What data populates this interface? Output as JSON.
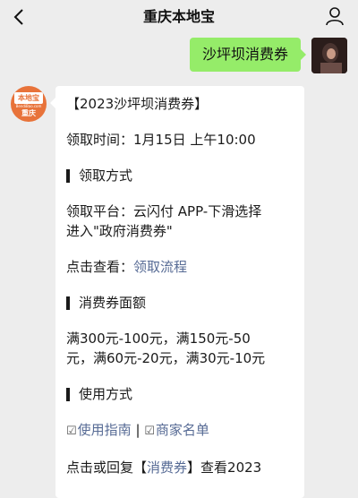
{
  "header": {
    "back_icon": "chevron-left-icon",
    "title": "重庆本地宝",
    "profile_icon": "person-icon"
  },
  "messages": {
    "outgoing": {
      "text": "沙坪坝消费券"
    },
    "bot_avatar": {
      "logo_text": "本地宝",
      "logo_sub": "BendiBao.com",
      "logo_city": "重庆"
    },
    "incoming": {
      "heading": "【2023沙坪坝消费券】",
      "time": "领取时间：1月15日 上午10:00",
      "sec1": "领取方式",
      "platform_line1": "领取平台：云闪付 APP-下滑选择",
      "platform_line2": "进入\"政府消费券\"",
      "view_prefix": "点击查看：",
      "view_link": "领取流程",
      "sec2": "消费券面额",
      "amount_line1": "满300元-100元，满150元-50",
      "amount_line2": "元，满60元-20元，满30元-10元",
      "sec3": "使用方式",
      "guide_link": "使用指南",
      "separator": " | ",
      "merchant_link": "商家名单",
      "reply_prefix": "点击或回复【",
      "reply_link": "消费券",
      "reply_suffix": "】查看2023"
    }
  }
}
